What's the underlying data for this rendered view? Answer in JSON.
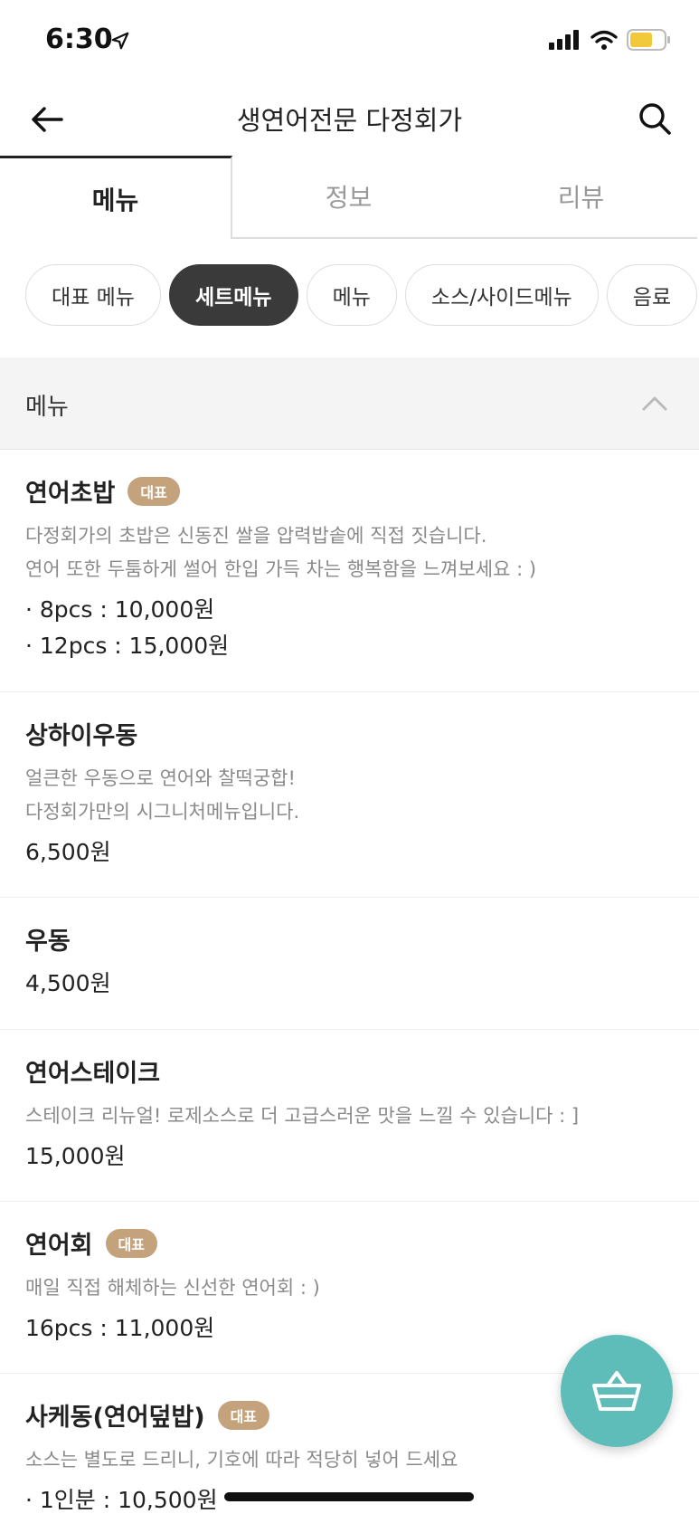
{
  "status_bar": {
    "time": "6:30"
  },
  "header": {
    "title": "생연어전문 다정회가"
  },
  "tabs": [
    {
      "label": "메뉴",
      "active": true
    },
    {
      "label": "정보",
      "active": false
    },
    {
      "label": "리뷰",
      "active": false
    }
  ],
  "category_chips": [
    {
      "label": "대표 메뉴",
      "active": false
    },
    {
      "label": "세트메뉴",
      "active": true
    },
    {
      "label": "메뉴",
      "active": false
    },
    {
      "label": "소스/사이드메뉴",
      "active": false
    },
    {
      "label": "음료",
      "active": false
    }
  ],
  "section": {
    "title": "메뉴"
  },
  "menu_items": [
    {
      "name": "연어초밥",
      "badge": "대표",
      "description": [
        "다정회가의 초밥은 신동진 쌀을 압력밥솥에 직접 짓습니다.",
        "연어 또한 두툼하게 썰어 한입 가득 차는 행복함을 느껴보세요 : )"
      ],
      "prices": [
        "· 8pcs : 10,000원",
        "· 12pcs : 15,000원"
      ]
    },
    {
      "name": "상하이우동",
      "badge": "",
      "description": [
        "얼큰한 우동으로 연어와 찰떡궁합!",
        "다정회가만의 시그니처메뉴입니다."
      ],
      "prices": [
        "6,500원"
      ]
    },
    {
      "name": "우동",
      "badge": "",
      "description": [],
      "prices": [
        "4,500원"
      ]
    },
    {
      "name": "연어스테이크",
      "badge": "",
      "description": [
        "스테이크 리뉴얼! 로제소스로 더 고급스러운 맛을 느낄 수 있습니다 : ]"
      ],
      "prices": [
        "15,000원"
      ]
    },
    {
      "name": "연어회",
      "badge": "대표",
      "description": [
        "매일 직접 해체하는 신선한 연어회 : )"
      ],
      "prices": [
        "16pcs : 11,000원"
      ]
    },
    {
      "name": "사케동(연어덮밥)",
      "badge": "대표",
      "description": [
        "소스는 별도로 드리니, 기호에 따라 적당히 넣어 드세요"
      ],
      "prices": [
        "· 1인분 : 10,500원"
      ]
    }
  ],
  "cart_button": {
    "icon": "basket-icon"
  },
  "colors": {
    "badge": "#c4a37c",
    "fab": "#5fbdb9",
    "chip_active": "#3a3a3a"
  }
}
